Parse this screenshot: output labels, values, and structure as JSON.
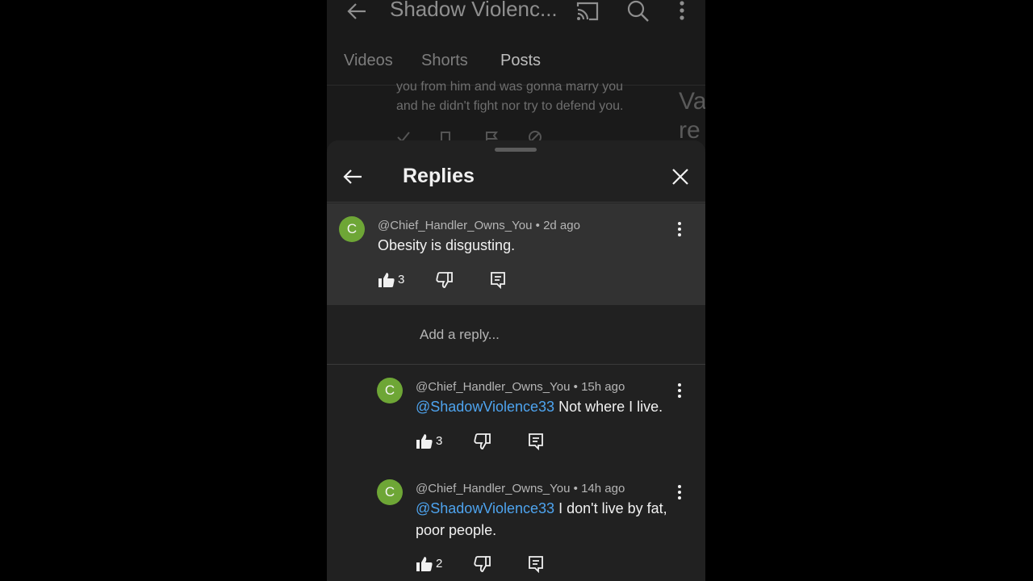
{
  "app_bar": {
    "title": "Shadow Violenc...",
    "icons": [
      "back-arrow-icon",
      "cast-icon",
      "search-icon",
      "more-vert-icon"
    ]
  },
  "tabs": [
    {
      "label": "Videos",
      "active": false
    },
    {
      "label": "Shorts",
      "active": false
    },
    {
      "label": "Posts",
      "active": true
    }
  ],
  "background_comment": {
    "text_line1": "you from him and was gonna marry you",
    "text_line2": "and he didn't fight nor try to defend you.",
    "thumb_text": "Va re"
  },
  "sheet": {
    "title": "Replies",
    "add_reply_placeholder": "Add a reply..."
  },
  "parent_comment": {
    "avatar_letter": "C",
    "author": "@Chief_Handler_Owns_You",
    "time": "2d ago",
    "text": "Obesity is disgusting.",
    "likes": "3"
  },
  "replies": [
    {
      "avatar_letter": "C",
      "author": "@Chief_Handler_Owns_You",
      "time": "15h ago",
      "mention": "@ShadowViolence33",
      "text": "Not where I live.",
      "text_line2": "",
      "likes": "3"
    },
    {
      "avatar_letter": "C",
      "author": "@Chief_Handler_Owns_You",
      "time": "14h ago",
      "mention": "@ShadowViolence33",
      "text": "I don't live by fat,",
      "text_line2": "poor people.",
      "likes": "2"
    }
  ],
  "colors": {
    "sheet_bg": "#212121",
    "parent_highlight": "#323232",
    "avatar": "#6ea636",
    "mention": "#4ea4ef"
  }
}
